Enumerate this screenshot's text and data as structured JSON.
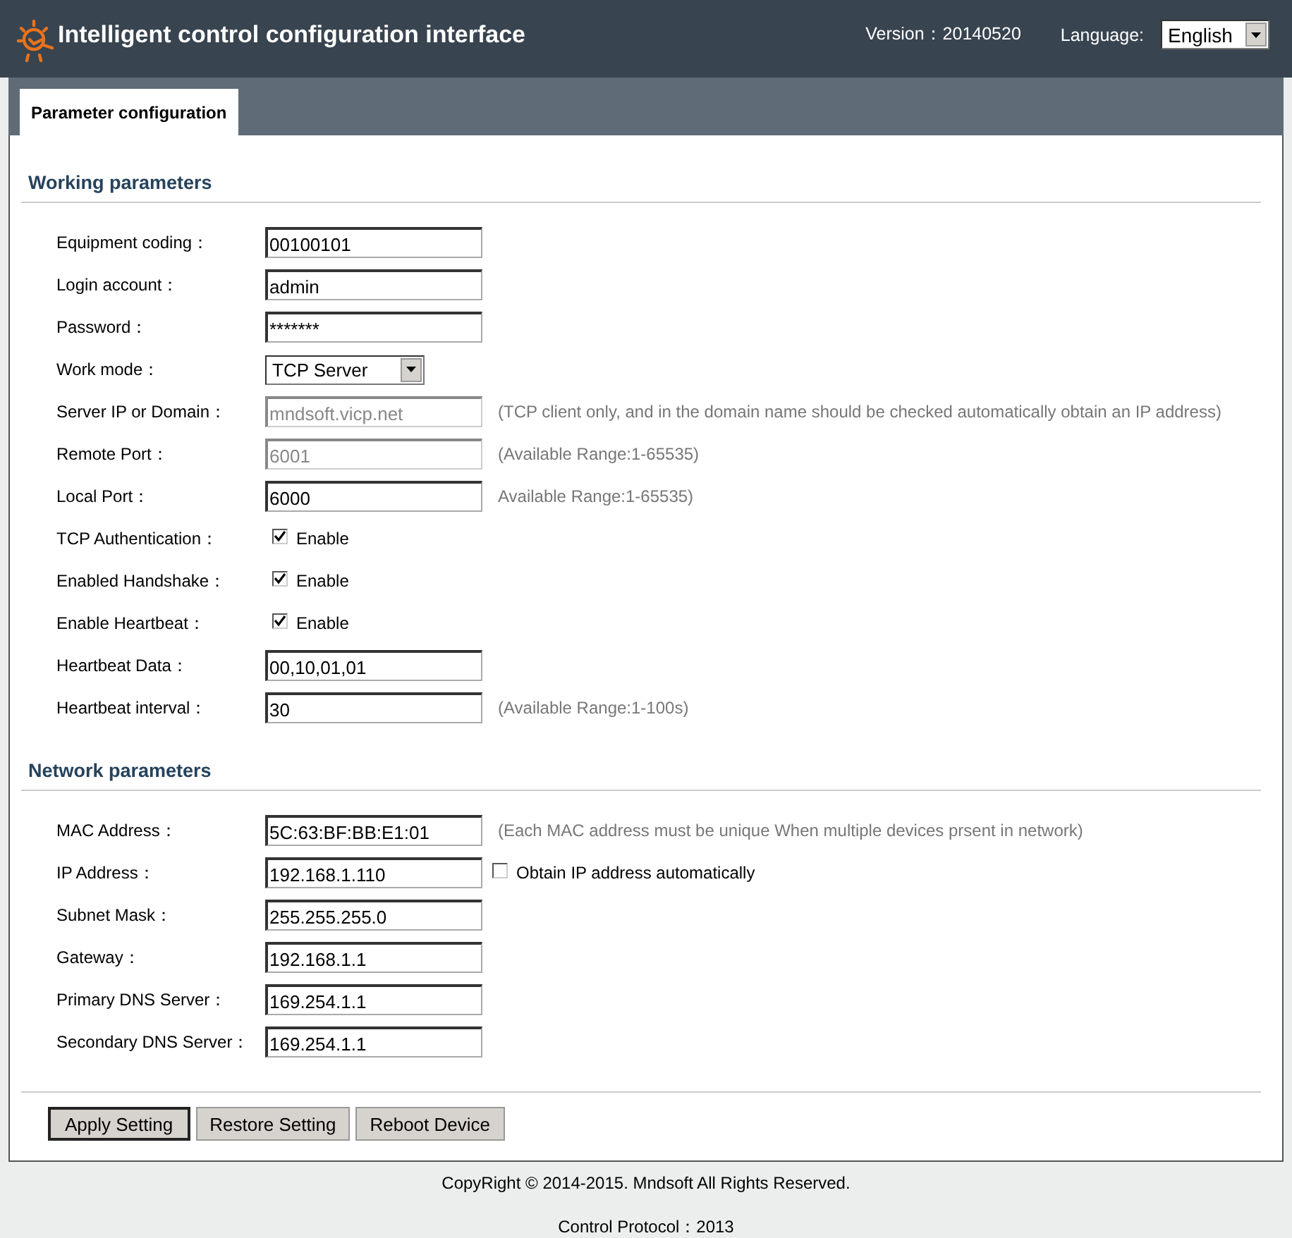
{
  "header": {
    "title": "Intelligent control configuration interface",
    "version_label": "Version：",
    "version": "20140520",
    "language_label": "Language:",
    "language": "English"
  },
  "tabs": [
    {
      "label": "Parameter configuration",
      "selected": true
    }
  ],
  "sections": [
    {
      "title": "Working parameters",
      "fields": [
        {
          "kind": "text",
          "label": "Equipment coding：",
          "value": "00100101",
          "disabled": false
        },
        {
          "kind": "text",
          "label": "Login account：",
          "value": "admin",
          "disabled": false
        },
        {
          "kind": "text",
          "label": "Password：",
          "value": "*******",
          "disabled": false
        },
        {
          "kind": "select",
          "label": "Work mode：",
          "value": "TCP Server"
        },
        {
          "kind": "text",
          "label": "Server IP or Domain：",
          "value": "mndsoft.vicp.net",
          "disabled": true,
          "hint": "(TCP client only, and in the domain name should be checked automatically obtain an IP address)"
        },
        {
          "kind": "text",
          "label": "Remote Port：",
          "value": "6001",
          "disabled": true,
          "hint": "(Available Range:1-65535)"
        },
        {
          "kind": "text",
          "label": "Local Port：",
          "value": "6000",
          "disabled": false,
          "hint": "Available Range:1-65535)"
        },
        {
          "kind": "checkbox",
          "label": "TCP Authentication：",
          "option": "Enable",
          "checked": true
        },
        {
          "kind": "checkbox",
          "label": "Enabled Handshake：",
          "option": "Enable",
          "checked": true
        },
        {
          "kind": "checkbox",
          "label": "Enable Heartbeat：",
          "option": "Enable",
          "checked": true
        },
        {
          "kind": "text",
          "label": "Heartbeat Data：",
          "value": "00,10,01,01",
          "disabled": false
        },
        {
          "kind": "text",
          "label": "Heartbeat interval：",
          "value": "30",
          "disabled": false,
          "hint": "(Available Range:1-100s)"
        }
      ]
    },
    {
      "title": "Network parameters",
      "fields": [
        {
          "kind": "text",
          "label": "MAC Address：",
          "value": "5C:63:BF:BB:E1:01",
          "disabled": false,
          "hint": "(Each MAC address must be unique When multiple devices prsent in network)"
        },
        {
          "kind": "text",
          "label": "IP Address：",
          "value": "192.168.1.110",
          "disabled": false,
          "option": "Obtain IP address automatically",
          "checked": false
        },
        {
          "kind": "text",
          "label": "Subnet Mask：",
          "value": "255.255.255.0",
          "disabled": false
        },
        {
          "kind": "text",
          "label": "Gateway：",
          "value": "192.168.1.1",
          "disabled": false
        },
        {
          "kind": "text",
          "label": "Primary DNS Server：",
          "value": "169.254.1.1",
          "disabled": false
        },
        {
          "kind": "text",
          "label": "Secondary DNS Server：",
          "value": "169.254.1.1",
          "disabled": false
        }
      ]
    }
  ],
  "buttons": [
    {
      "label": "Apply Setting",
      "default": true
    },
    {
      "label": "Restore Setting",
      "default": false
    },
    {
      "label": "Reboot Device",
      "default": false
    }
  ],
  "footer": {
    "copyright": "CopyRight © 2014-2015. Mndsoft All Rights Reserved.",
    "protocol": "Control Protocol：2013"
  }
}
